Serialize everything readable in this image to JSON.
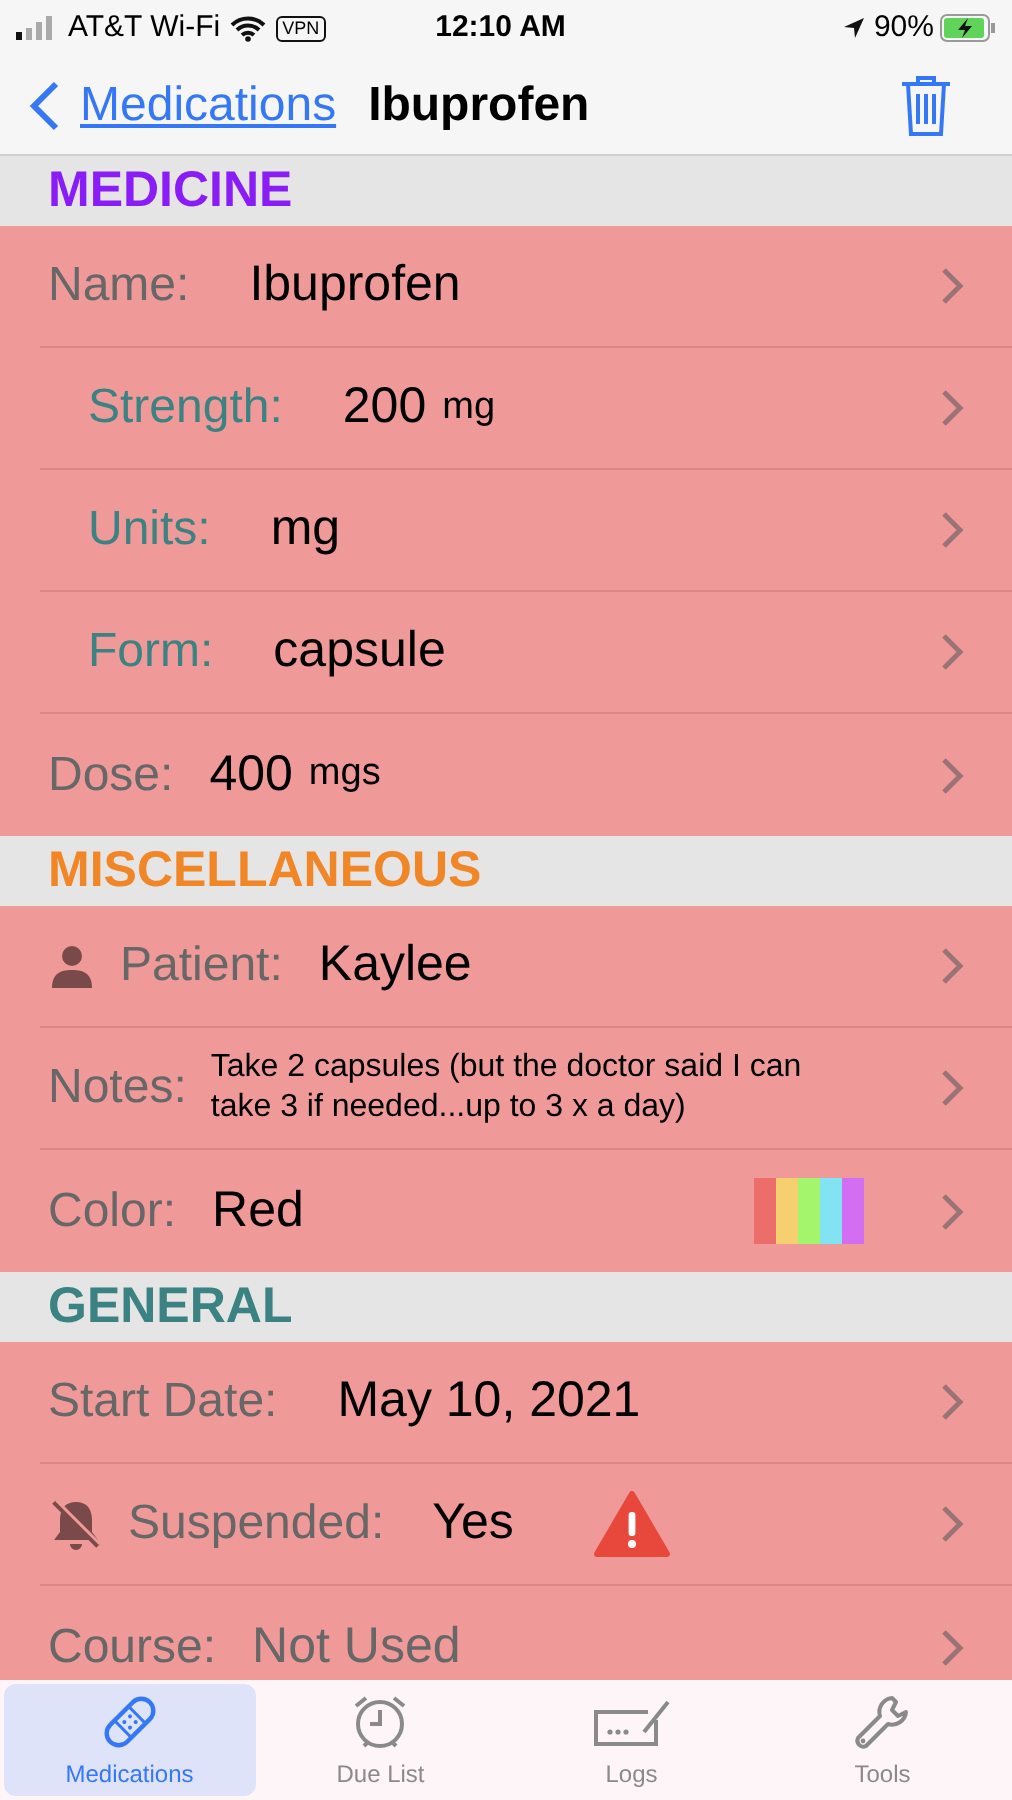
{
  "status_bar": {
    "carrier": "AT&T Wi-Fi",
    "vpn": "VPN",
    "time": "12:10 AM",
    "battery": "90%"
  },
  "nav": {
    "back": "Medications",
    "title": "Ibuprofen"
  },
  "sections": [
    {
      "title": "MEDICINE",
      "color": "#8a1cf5",
      "rows": [
        {
          "kind": "plain",
          "label": "Name:",
          "value": "Ibuprofen",
          "dimmed": false
        },
        {
          "kind": "sub",
          "label": "Strength:",
          "value": "200",
          "unit": "mg",
          "dimmed": false
        },
        {
          "kind": "sub",
          "label": "Units:",
          "value": "mg",
          "dimmed": false
        },
        {
          "kind": "sub",
          "label": "Form:",
          "value": "capsule",
          "dimmed": false
        },
        {
          "kind": "plain",
          "label": "Dose:",
          "value": "400",
          "unit": "mgs",
          "dimmed": false
        }
      ]
    },
    {
      "title": "MISCELLANEOUS",
      "color": "#f08626",
      "rows": [
        {
          "kind": "person",
          "label": "Patient:",
          "value": "Kaylee",
          "dimmed": false
        },
        {
          "kind": "notes",
          "label": "Notes:",
          "value": "Take 2 capsules (but the doctor said I can take 3 if needed...up to 3 x a day)",
          "dimmed": false
        },
        {
          "kind": "swatch",
          "label": "Color:",
          "value": "Red",
          "dimmed": false
        }
      ]
    },
    {
      "title": "GENERAL",
      "color": "#3b8282",
      "rows": [
        {
          "kind": "plain",
          "label": "Start Date:",
          "value": "May 10, 2021",
          "dimmed": false
        },
        {
          "kind": "suspended",
          "label": "Suspended:",
          "value": "Yes",
          "dimmed": false
        },
        {
          "kind": "plain",
          "label": "Course:",
          "value": "Not Used",
          "dimmed": true
        }
      ]
    }
  ],
  "tabs": [
    {
      "label": "Medications",
      "selected": true
    },
    {
      "label": "Due List",
      "selected": false
    },
    {
      "label": "Logs",
      "selected": false
    },
    {
      "label": "Tools",
      "selected": false
    }
  ]
}
